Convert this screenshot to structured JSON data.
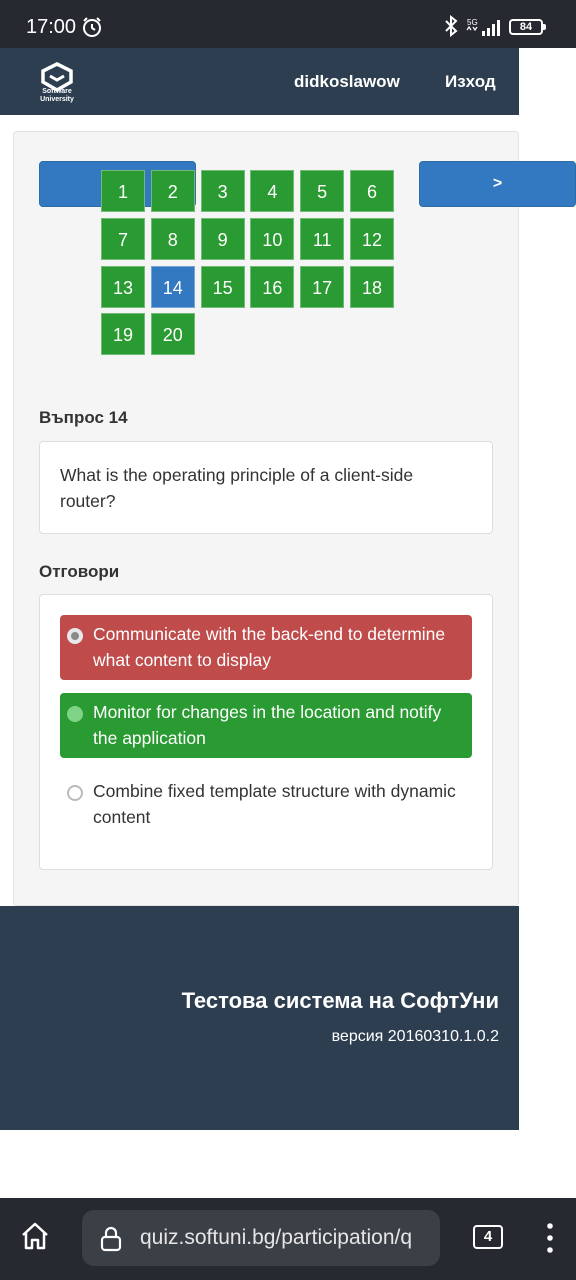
{
  "status_bar": {
    "time": "17:00",
    "battery": "84",
    "network": "5G"
  },
  "header": {
    "logo_line1": "Software",
    "logo_line2": "University",
    "username": "didkoslawow",
    "logout": "Изход"
  },
  "navigation": {
    "next_label": ">"
  },
  "question_numbers": [
    "1",
    "2",
    "3",
    "4",
    "5",
    "6",
    "7",
    "8",
    "9",
    "10",
    "11",
    "12",
    "13",
    "14",
    "15",
    "16",
    "17",
    "18",
    "19",
    "20"
  ],
  "active_question": "14",
  "question": {
    "label": "Въпрос 14",
    "text": "What is the operating principle of a client-side router?"
  },
  "answers": {
    "label": "Отговори",
    "items": [
      {
        "text": "Communicate with the back-end to determine what content to display",
        "state": "wrong"
      },
      {
        "text": "Monitor for changes in the location and notify the application",
        "state": "correct"
      },
      {
        "text": "Combine fixed template structure with dynamic content",
        "state": "neutral"
      }
    ]
  },
  "footer": {
    "title": "Тестова система на СофтУни",
    "version": "версия 20160310.1.0.2"
  },
  "browser": {
    "url": "quiz.softuni.bg/participation/q",
    "tab_count": "4"
  },
  "colors": {
    "header_bg": "#2c3e50",
    "success": "#2a9a32",
    "danger": "#bf4b4b",
    "primary": "#3379c2"
  }
}
